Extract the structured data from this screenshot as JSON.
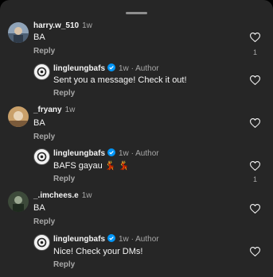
{
  "comments": [
    {
      "username": "harry.w_510",
      "time": "1w",
      "text": "BA",
      "reply_label": "Reply",
      "likes": "1",
      "replies": [
        {
          "username": "lingleungbafs",
          "time": "1w",
          "badge": "Author",
          "text": "Sent you a message! Check it out!",
          "reply_label": "Reply"
        }
      ]
    },
    {
      "username": "_fryany",
      "time": "1w",
      "text": "BA",
      "reply_label": "Reply",
      "replies": [
        {
          "username": "lingleungbafs",
          "time": "1w",
          "badge": "Author",
          "text": "BAFS gayau",
          "emoji": "💃 💃",
          "reply_label": "Reply",
          "likes": "1"
        }
      ]
    },
    {
      "username": "_.imchees.e",
      "time": "1w",
      "text": "BA",
      "reply_label": "Reply",
      "replies": [
        {
          "username": "lingleungbafs",
          "time": "1w",
          "badge": "Author",
          "text": "Nice! Check your DMs!",
          "reply_label": "Reply"
        }
      ]
    }
  ],
  "colors": {
    "background": "#262626",
    "text_primary": "#f5f5f5",
    "text_secondary": "#a8a8a8",
    "verified_blue": "#0095f6"
  },
  "icons": {
    "like": "heart-outline-icon",
    "verified": "verified-badge-icon"
  }
}
